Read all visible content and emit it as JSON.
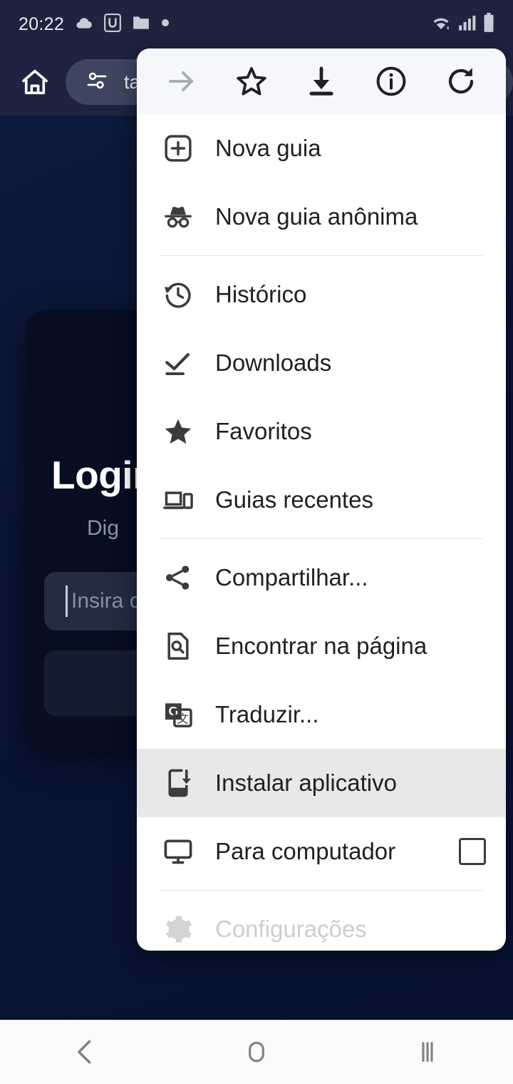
{
  "status_bar": {
    "time": "20:22",
    "left_icons": [
      "cloud-icon",
      "u-app-icon",
      "folder-icon",
      "dot-icon"
    ],
    "right_icons": [
      "wifi-icon",
      "signal-icon",
      "battery-icon"
    ]
  },
  "browser_toolbar": {
    "home_icon": "home-icon",
    "omnibox_icon": "page-settings-icon",
    "omnibox_text": "ta"
  },
  "webpage": {
    "title": "Login",
    "subtitle": "Dig",
    "input_placeholder": "Insira o",
    "button_label": ""
  },
  "menu": {
    "header_buttons": [
      {
        "name": "forward-arrow-icon",
        "label": "Avançar",
        "disabled": true
      },
      {
        "name": "star-outline-icon",
        "label": "Favoritar",
        "disabled": false
      },
      {
        "name": "download-icon",
        "label": "Fazer download",
        "disabled": false
      },
      {
        "name": "info-circle-icon",
        "label": "Informações da página",
        "disabled": false
      },
      {
        "name": "reload-icon",
        "label": "Atualizar",
        "disabled": false
      }
    ],
    "groups": [
      {
        "items": [
          {
            "label": "Nova guia",
            "icon": "new-tab-icon"
          },
          {
            "label": "Nova guia anônima",
            "icon": "incognito-icon"
          }
        ]
      },
      {
        "items": [
          {
            "label": "Histórico",
            "icon": "history-icon"
          },
          {
            "label": "Downloads",
            "icon": "downloads-icon"
          },
          {
            "label": "Favoritos",
            "icon": "star-filled-icon"
          },
          {
            "label": "Guias recentes",
            "icon": "recent-tabs-icon"
          }
        ]
      },
      {
        "items": [
          {
            "label": "Compartilhar...",
            "icon": "share-icon"
          },
          {
            "label": "Encontrar na página",
            "icon": "find-in-page-icon"
          },
          {
            "label": "Traduzir...",
            "icon": "translate-icon"
          },
          {
            "label": "Instalar aplicativo",
            "icon": "install-app-icon",
            "highlighted": true
          },
          {
            "label": "Para computador",
            "icon": "desktop-icon",
            "checkbox": true,
            "checked": false
          }
        ]
      },
      {
        "items": [
          {
            "label": "Configurações",
            "icon": "settings-gear-icon",
            "cut_off": true
          }
        ]
      }
    ]
  },
  "nav_bar": {
    "back_label": "Voltar",
    "home_label": "Início",
    "recents_label": "Recentes"
  },
  "colors": {
    "status_bar_bg": "#1e2440",
    "page_bg": "#0a1535",
    "card_bg": "#070e22",
    "menu_bg": "#ffffff",
    "menu_header_bg": "#f6f7fa",
    "highlight_bg": "#e8e8e8",
    "text_dark": "#1f2023",
    "nav_bar_bg": "#fbfbfb"
  }
}
